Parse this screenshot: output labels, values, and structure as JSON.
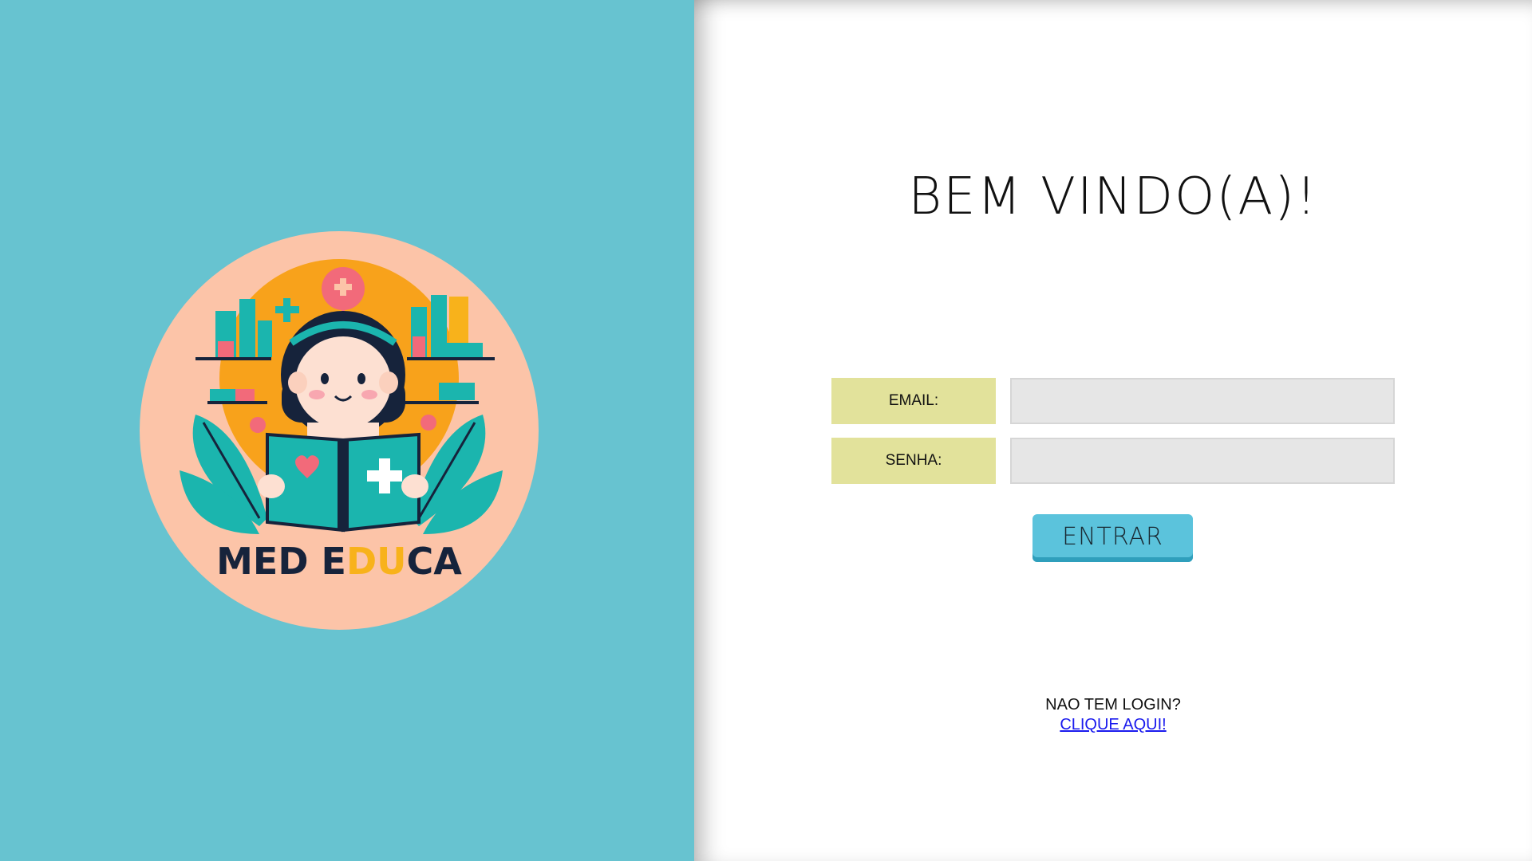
{
  "brand": {
    "logo_text_part1": "MED E",
    "logo_text_part2": "DU",
    "logo_text_part3": "CA",
    "colors": {
      "left_panel_bg": "#67c3d0",
      "logo_circle": "#fcc4a8",
      "logo_sun": "#f8a21b",
      "logo_teal": "#1bb5ae",
      "logo_navy": "#16233b",
      "logo_accent_yellow": "#f8b21b",
      "logo_pink": "#f26a7a"
    }
  },
  "login": {
    "title": "BEM VINDO(A)!",
    "email_label": "EMAIL:",
    "email_value": "",
    "password_label": "SENHA:",
    "password_value": "",
    "submit_label": "ENTRAR",
    "colors": {
      "label_bg": "#e2e29b",
      "input_bg": "#e6e6e6",
      "button_bg": "#5bc3dc"
    }
  },
  "register": {
    "prompt": "NAO TEM LOGIN?",
    "link_label": "CLIQUE AQUI!"
  }
}
